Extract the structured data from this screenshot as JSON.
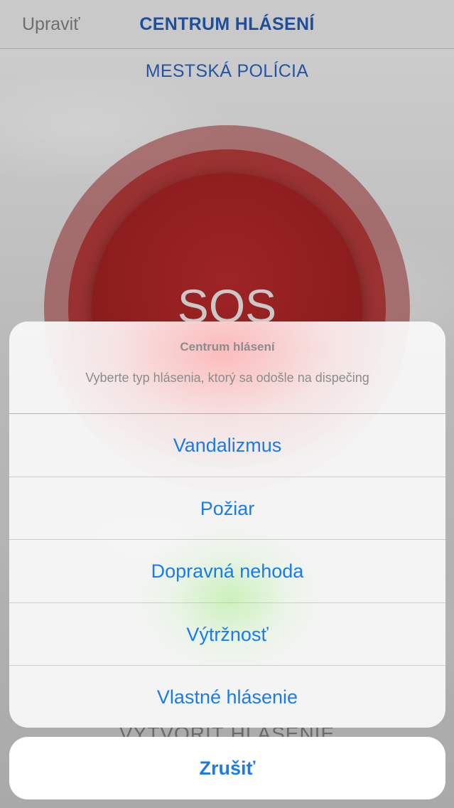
{
  "navbar": {
    "edit_label": "Upraviť",
    "title": "CENTRUM HLÁSENÍ"
  },
  "main": {
    "subtitle": "MESTSKÁ POLÍCIA",
    "sos_label": "SOS",
    "create_report_label": "VYTVORIŤ HLÁSENIE"
  },
  "action_sheet": {
    "title": "Centrum hlásení",
    "message": "Vyberte typ hlásenia, ktorý sa odošle na dispečing",
    "options": [
      {
        "label": "Vandalizmus"
      },
      {
        "label": "Požiar"
      },
      {
        "label": "Dopravná nehoda"
      },
      {
        "label": "Výtržnosť"
      },
      {
        "label": "Vlastné hlásenie"
      }
    ],
    "cancel_label": "Zrušiť"
  },
  "colors": {
    "accent_blue": "#1a7bea",
    "nav_title_blue": "#1f4f9a",
    "sos_red": "#8a1c1c"
  }
}
